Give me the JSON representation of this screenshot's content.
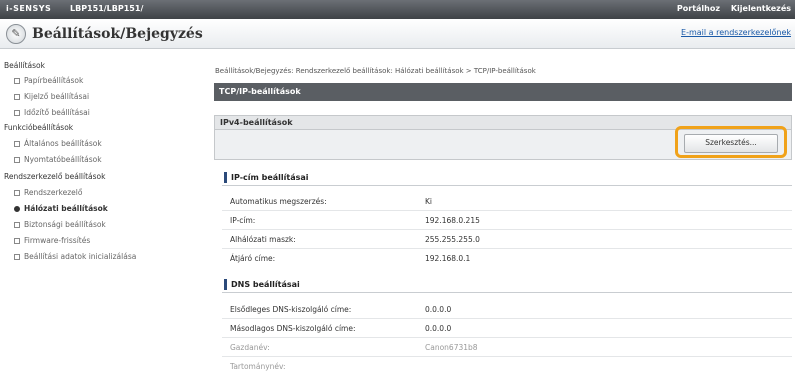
{
  "topbar": {
    "brand": "i-SENSYS",
    "model": "LBP151/LBP151/",
    "links": [
      "Portálhoz",
      "Kijelentkezés"
    ]
  },
  "header": {
    "title": "Beállítások/Bejegyzés",
    "email_link": "E-mail a rendszerkezelőnek"
  },
  "sidebar": {
    "groups": [
      {
        "label": "Beállítások",
        "items": [
          {
            "label": "Papírbeállítások"
          },
          {
            "label": "Kijelző beállításai"
          },
          {
            "label": "Időzítő beállításai"
          }
        ]
      },
      {
        "label": "Funkcióbeállítások",
        "items": [
          {
            "label": "Általános beállítások"
          },
          {
            "label": "Nyomtatóbeállítások"
          }
        ]
      },
      {
        "label": "Rendszerkezelő beállítások",
        "items": [
          {
            "label": "Rendszerkezelő"
          },
          {
            "label": "Hálózati beállítások",
            "active": true
          },
          {
            "label": "Biztonsági beállítások"
          },
          {
            "label": "Firmware-frissítés"
          },
          {
            "label": "Beállítási adatok inicializálása"
          }
        ]
      }
    ]
  },
  "main": {
    "breadcrumb": "Beállítások/Bejegyzés: Rendszerkezelő beállítások: Hálózati beállítások > TCP/IP-beállítások",
    "section_title": "TCP/IP-beállítások",
    "subsection_title": "IPv4-beállítások",
    "edit_button": "Szerkesztés...",
    "ip_group": {
      "title": "IP-cím beállításai",
      "rows": [
        {
          "label": "Automatikus megszerzés:",
          "value": "Ki"
        },
        {
          "label": "IP-cím:",
          "value": "192.168.0.215"
        },
        {
          "label": "Alhálózati maszk:",
          "value": "255.255.255.0"
        },
        {
          "label": "Átjáró címe:",
          "value": "192.168.0.1"
        }
      ]
    },
    "dns_group": {
      "title": "DNS beállításai",
      "rows": [
        {
          "label": "Elsődleges DNS-kiszolgáló címe:",
          "value": "0.0.0.0"
        },
        {
          "label": "Másodlagos DNS-kiszolgáló címe:",
          "value": "0.0.0.0",
          "dim": false
        },
        {
          "label": "Gazdanév:",
          "value": "Canon6731b8",
          "dim": true
        },
        {
          "label": "Tartománynév:",
          "value": "",
          "dim": true
        }
      ]
    }
  }
}
